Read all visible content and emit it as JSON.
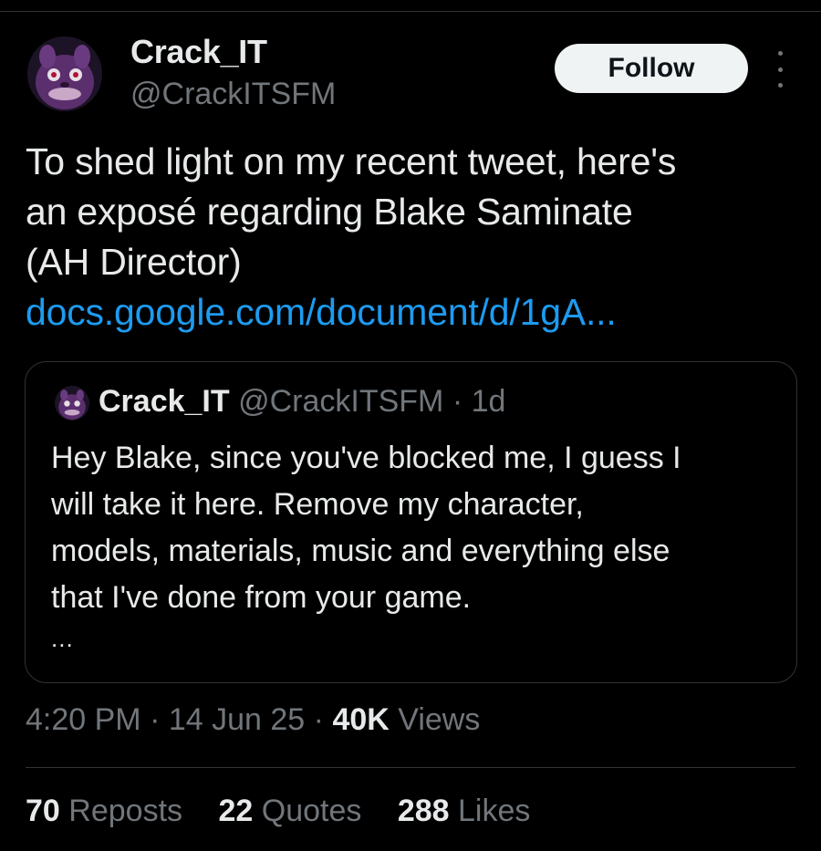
{
  "author": {
    "display_name": "Crack_IT",
    "handle": "@CrackITSFM"
  },
  "follow_label": "Follow",
  "tweet": {
    "lines": [
      "To shed light on my recent tweet, here's",
      "an exposé regarding Blake Saminate",
      "(AH Director)"
    ],
    "link_text": "docs.google.com/document/d/1gA..."
  },
  "quote": {
    "display_name": "Crack_IT",
    "handle": "@CrackITSFM",
    "separator": "·",
    "time": "1d",
    "lines": [
      "Hey Blake, since you've blocked me, I guess I",
      "will take it here.  Remove my character,",
      "models, materials, music and everything else",
      "that I've done from your game."
    ],
    "ellipsis": "..."
  },
  "meta": {
    "time": "4:20 PM",
    "separator": "·",
    "date": "14 Jun 25",
    "views_count": "40K",
    "views_label": "Views"
  },
  "stats": {
    "reposts_count": "70",
    "reposts_label": "Reposts",
    "quotes_count": "22",
    "quotes_label": "Quotes",
    "likes_count": "288",
    "likes_label": "Likes"
  },
  "colors": {
    "background": "#000000",
    "text_primary": "#e7e9ea",
    "text_secondary": "#71767b",
    "link": "#1d9bf0",
    "border": "#2f3336",
    "follow_bg": "#eff3f4"
  },
  "icons": {
    "more": "more-vertical-icon"
  }
}
